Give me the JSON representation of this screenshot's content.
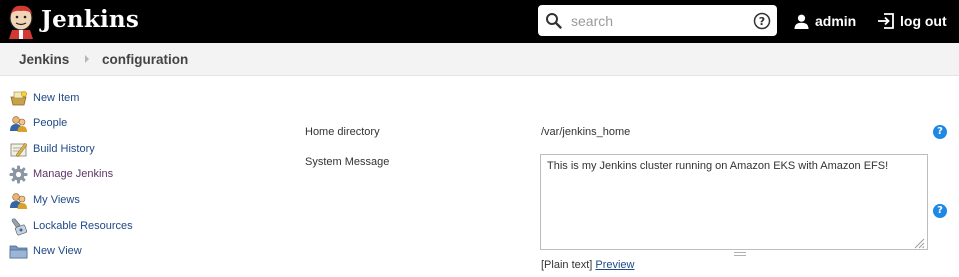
{
  "header": {
    "brand": "Jenkins",
    "search": {
      "placeholder": "search",
      "value": ""
    },
    "user": "admin",
    "logout": "log out"
  },
  "breadcrumb": [
    "Jenkins",
    "configuration"
  ],
  "sidebar": {
    "items": [
      {
        "label": "New Item",
        "icon": "new-item-icon"
      },
      {
        "label": "People",
        "icon": "people-icon"
      },
      {
        "label": "Build History",
        "icon": "build-history-icon"
      },
      {
        "label": "Manage Jenkins",
        "icon": "manage-jenkins-gear-icon"
      },
      {
        "label": "My Views",
        "icon": "my-views-icon"
      },
      {
        "label": "Lockable Resources",
        "icon": "lockable-resources-icon"
      },
      {
        "label": "New View",
        "icon": "new-view-folder-icon"
      }
    ]
  },
  "form": {
    "home_directory": {
      "label": "Home directory",
      "value": "/var/jenkins_home"
    },
    "system_message": {
      "label": "System Message",
      "value": "This is my Jenkins cluster running on Amazon EKS with Amazon EFS!",
      "format": "[Plain text]",
      "preview": "Preview"
    },
    "help_symbol": "?"
  },
  "colors": {
    "header_bg": "#000000",
    "link": "#204a87",
    "visited_link": "#5c3566",
    "help": "#1e88e5",
    "breadcrumb_bg": "#f3f3f3"
  }
}
